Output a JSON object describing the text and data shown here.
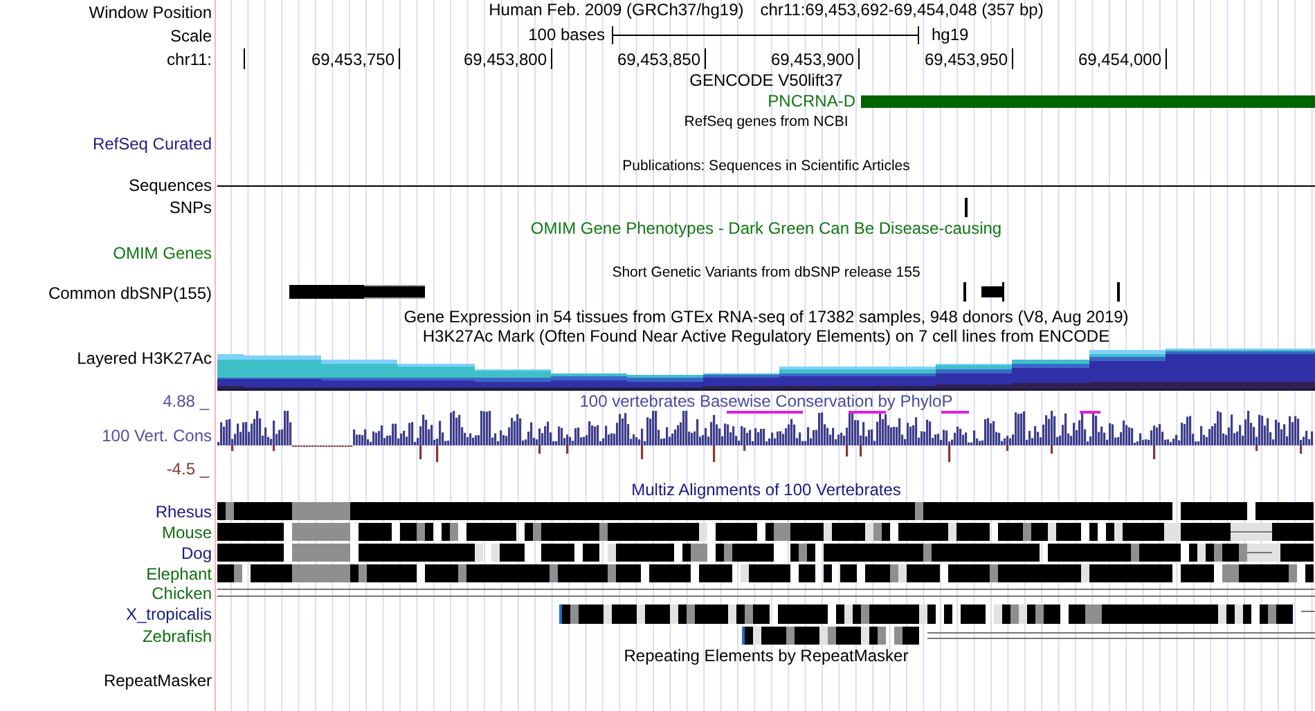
{
  "header": {
    "label": "Window Position",
    "title": "Human Feb. 2009 (GRCh37/hg19)",
    "position": "chr11:69,453,692-69,454,048 (357 bp)"
  },
  "scale": {
    "label": "Scale",
    "length": "100 bases",
    "assembly": "hg19"
  },
  "ruler": {
    "label": "chr11:",
    "ticks": [
      "69,453,750",
      "69,453,800",
      "69,453,850",
      "69,453,900",
      "69,453,950",
      "69,454,000"
    ]
  },
  "gencode": {
    "caption": "GENCODE V50lift37",
    "gene": "PNCRNA-D"
  },
  "refseq": {
    "caption": "RefSeq genes from NCBI",
    "label": "RefSeq Curated"
  },
  "publications": {
    "caption": "Publications: Sequences in Scientific Articles",
    "label": "Sequences"
  },
  "snps": {
    "label": "SNPs"
  },
  "omim": {
    "caption": "OMIM Gene Phenotypes - Dark Green Can Be Disease-causing",
    "label": "OMIM Genes"
  },
  "dbsnp": {
    "caption": "Short Genetic Variants from dbSNP release 155",
    "label": "Common dbSNP(155)"
  },
  "gtex": {
    "caption": "Gene Expression in 54 tissues from GTEx RNA-seq of 17382 samples, 948 donors (V8, Aug 2019)"
  },
  "h3k27ac": {
    "caption": "H3K27Ac Mark (Often Found Near Active Regulatory Elements) on 7 cell lines from ENCODE",
    "label": "Layered H3K27Ac"
  },
  "conservation": {
    "max": "4.88 _",
    "label": "100 Vert. Cons",
    "min": "-4.5 _",
    "caption": "100 vertebrates Basewise Conservation by PhyloP"
  },
  "multiz": {
    "caption": "Multiz Alignments of 100 Vertebrates",
    "species": [
      {
        "name": "Rhesus",
        "color": "#1a1a80",
        "kind": "blocks"
      },
      {
        "name": "Mouse",
        "color": "#0f6e0f",
        "kind": "blocks"
      },
      {
        "name": "Dog",
        "color": "#1a1a80",
        "kind": "blocks"
      },
      {
        "name": "Elephant",
        "color": "#0f6e0f",
        "kind": "blocks"
      },
      {
        "name": "Chicken",
        "color": "#0f6e0f",
        "kind": "gap"
      },
      {
        "name": "X_tropicalis",
        "color": "#1a1a80",
        "kind": "partial"
      },
      {
        "name": "Zebrafish",
        "color": "#0f6e0f",
        "kind": "partial"
      }
    ]
  },
  "repeatmasker": {
    "caption": "Repeating Elements by RepeatMasker",
    "label": "RepeatMasker"
  }
}
